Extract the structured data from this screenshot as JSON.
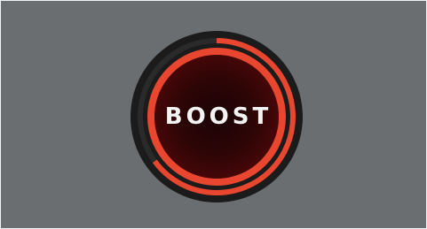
{
  "boost_control": {
    "label": "BOOST",
    "level_percent": 65,
    "icon": "power-dial-icon",
    "colors": {
      "background": "#6b6e71",
      "outer_bezel": "#1b1b1b",
      "accent_red": "#e8462f",
      "core_dark": "#1a0405",
      "core_mid": "#5c0b0c",
      "label": "#f3f3f3"
    }
  }
}
